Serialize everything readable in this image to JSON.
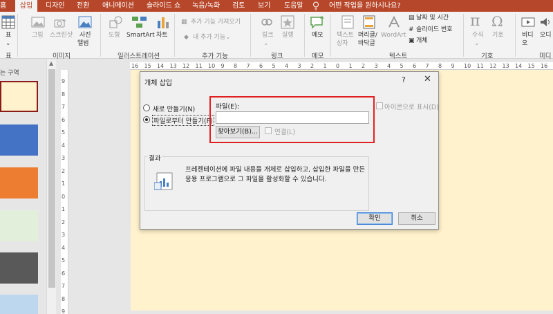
{
  "tabs": [
    {
      "label": "홈",
      "active": false
    },
    {
      "label": "삽입",
      "active": true
    },
    {
      "label": "디자인",
      "active": false
    },
    {
      "label": "전환",
      "active": false
    },
    {
      "label": "애니메이션",
      "active": false
    },
    {
      "label": "슬라이드 쇼",
      "active": false
    },
    {
      "label": "녹음/녹화",
      "active": false
    },
    {
      "label": "검토",
      "active": false
    },
    {
      "label": "보기",
      "active": false
    },
    {
      "label": "도움말",
      "active": false
    }
  ],
  "tell_me": "어떤 작업을 원하시나요?",
  "ribbon": {
    "table": "표",
    "images": {
      "picture": "그림",
      "screenshot": "스크린샷",
      "album_line1": "사진",
      "album_line2": "앨범"
    },
    "illustrations": {
      "shapes": "도형",
      "smartart": "SmartArt",
      "chart": "차트"
    },
    "addins": {
      "get": "추가 기능 가져오기",
      "my": "내 추가 기능"
    },
    "links": {
      "link": "링크",
      "action": "실행"
    },
    "comments": {
      "comment": "메모"
    },
    "text": {
      "textbox_line1": "텍스트",
      "textbox_line2": "상자",
      "header_line1": "머리글/",
      "header_line2": "바닥글",
      "wordart": "WordArt",
      "datetime": "날짜 및 시간",
      "slide_number": "슬라이드 번호",
      "object": "개체"
    },
    "symbols": {
      "equation": "수식",
      "symbol": "기호"
    },
    "media": {
      "video_line1": "비디",
      "video_line2": "오",
      "audio_line1": "오디"
    },
    "groups": {
      "table": "표",
      "images": "이미지",
      "illustrations": "일러스트레이션",
      "addins": "추가 기능",
      "links": "링크",
      "comments": "메모",
      "text": "텍스트",
      "symbols": "기호",
      "media": "미디"
    }
  },
  "left_panel": {
    "section_label": "는 구역",
    "thumbnail_colors": [
      "#fff2cc",
      "#4472c4",
      "#ed7d31",
      "#e2efda",
      "#595959",
      "#bdd7ee"
    ]
  },
  "ruler_h": [
    "16",
    "15",
    "14",
    "13",
    "12",
    "11",
    "10",
    "9",
    "8",
    "7",
    "6",
    "5",
    "4",
    "3",
    "2",
    "1",
    "0",
    "1",
    "2",
    "3",
    "4",
    "5",
    "6",
    "7",
    "8",
    "9",
    "10",
    "11",
    "12",
    "13",
    "14",
    "15",
    "16"
  ],
  "ruler_v": [
    "9",
    "8",
    "7",
    "6",
    "5",
    "4",
    "3",
    "2",
    "1",
    "0",
    "1",
    "2",
    "3",
    "4",
    "5",
    "6",
    "7",
    "8",
    "9"
  ],
  "dialog": {
    "title": "개체 삽입",
    "help": "?",
    "close": "✕",
    "radio_new": "새로 만들기(N)",
    "radio_from_file": "파일로부터 만들기(F)",
    "file_label": "파일(E):",
    "file_value": "",
    "browse": "찾아보기(B)...",
    "link": "연결(L)",
    "display_as_icon": "아이콘으로 표시(D)",
    "result_title": "결과",
    "result_text": "프레젠테이션에 파일 내용을 개체로 삽입하고, 삽입한 파일을 만든 응용 프로그램으로 그 파일을 활성화할 수 있습니다.",
    "ok": "확인",
    "cancel": "취소"
  }
}
